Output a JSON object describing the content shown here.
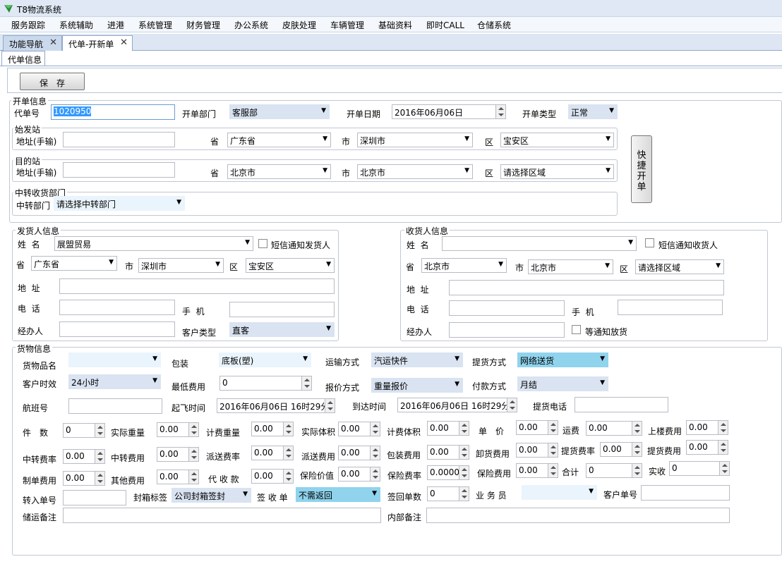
{
  "window": {
    "title": "T8物流系统"
  },
  "menu": [
    "服务跟踪",
    "系统辅助",
    "进港",
    "系统管理",
    "财务管理",
    "办公系统",
    "皮肤处理",
    "车辆管理",
    "基础资料",
    "即时CALL",
    "仓储系统"
  ],
  "tabs": [
    {
      "label": "功能导航",
      "close": "✕"
    },
    {
      "label": "代单-开新单",
      "close": "✕"
    }
  ],
  "subtab": "代单信息",
  "toolbar": {
    "save": "保　存"
  },
  "quick_button": "快捷开单",
  "open": {
    "legend": "开单信息",
    "bill_no_label": "代单号",
    "bill_no": "1020950",
    "dept_label": "开单部门",
    "dept": "客服部",
    "date_label": "开单日期",
    "date": "2016年06月06日",
    "type_label": "开单类型",
    "type": "正常"
  },
  "origin": {
    "legend": "始发站",
    "addr_label": "地址(手输)",
    "addr": "",
    "prov_label": "省",
    "prov": "广东省",
    "city_label": "市",
    "city": "深圳市",
    "dist_label": "区",
    "dist": "宝安区"
  },
  "dest": {
    "legend": "目的站",
    "addr_label": "地址(手输)",
    "addr": "",
    "prov_label": "省",
    "prov": "北京市",
    "city_label": "市",
    "city": "北京市",
    "dist_label": "区",
    "dist": "请选择区域"
  },
  "transfer": {
    "legend": "中转收货部门",
    "label": "中转部门",
    "value": "请选择中转部门"
  },
  "sender": {
    "legend": "发货人信息",
    "name_label": "姓  名",
    "name": "展盟贸易",
    "sms": "短信通知发货人",
    "prov_label": "省",
    "prov": "广东省",
    "city_label": "市",
    "city": "深圳市",
    "dist_label": "区",
    "dist": "宝安区",
    "addr_label": "地  址",
    "tel_label": "电  话",
    "mobile_label": "手  机",
    "agent_label": "经办人",
    "ctype_label": "客户类型",
    "ctype": "直客"
  },
  "receiver": {
    "legend": "收货人信息",
    "name_label": "姓  名",
    "name": "",
    "sms": "短信通知收货人",
    "prov_label": "省",
    "prov": "北京市",
    "city_label": "市",
    "city": "北京市",
    "dist_label": "区",
    "dist": "请选择区域",
    "addr_label": "地  址",
    "tel_label": "电  话",
    "mobile_label": "手  机",
    "agent_label": "经办人",
    "wait": "等通知放货"
  },
  "goods": {
    "legend": "货物信息",
    "name_label": "货物品名",
    "name": "",
    "pack_label": "包装",
    "pack": "底板(塑)",
    "trans_label": "运输方式",
    "trans": "汽运快件",
    "pick_label": "提货方式",
    "pick": "网络送货",
    "aging_label": "客户时效",
    "aging": "24小时",
    "minfee_label": "最低费用",
    "minfee": "0",
    "quote_label": "报价方式",
    "quote": "重量报价",
    "pay_label": "付款方式",
    "pay": "月结",
    "flight_label": "航班号",
    "flight": "",
    "dep_label": "起飞时间",
    "dep": "2016年06月06日 16时29分",
    "arr_label": "到达时间",
    "arr": "2016年06月06日 16时29分",
    "pickphone_label": "提货电话",
    "pickphone": "",
    "row1": [
      {
        "label": "件　数",
        "value": "0"
      },
      {
        "label": "实际重量",
        "value": "0.00"
      },
      {
        "label": "计费重量",
        "value": "0.00"
      },
      {
        "label": "实际体积",
        "value": "0.00"
      },
      {
        "label": "计费体积",
        "value": "0.00"
      },
      {
        "label": "单　价",
        "value": "0.00"
      },
      {
        "label": "运费",
        "value": "0.00"
      },
      {
        "label": "上楼费用",
        "value": "0.00"
      }
    ],
    "row2": [
      {
        "label": "中转费率",
        "value": "0.00"
      },
      {
        "label": "中转费用",
        "value": "0.00"
      },
      {
        "label": "派送费率",
        "value": "0.00"
      },
      {
        "label": "派送费用",
        "value": "0.00"
      },
      {
        "label": "包装费用",
        "value": "0.00"
      },
      {
        "label": "卸货费用",
        "value": "0.00"
      },
      {
        "label": "提货费率",
        "value": "0.00"
      },
      {
        "label": "提货费用",
        "value": "0.00"
      }
    ],
    "row3": [
      {
        "label": "制单费用",
        "value": "0.00"
      },
      {
        "label": "其他费用",
        "value": "0.00"
      },
      {
        "label": "代 收 款",
        "value": "0.00"
      },
      {
        "label": "保险价值",
        "value": "0.00"
      },
      {
        "label": "保险费率",
        "value": "0.0000"
      },
      {
        "label": "保险费用",
        "value": "0.00"
      },
      {
        "label": "合计",
        "value": "0"
      },
      {
        "label": "实收",
        "value": "0"
      }
    ],
    "in_label": "转入单号",
    "in": "",
    "seal_label": "封箱标签",
    "seal": "公司封箱签封",
    "sign_label": "签 收 单",
    "sign": "不需返回",
    "signcount_label": "签回单数",
    "signcount": "0",
    "sales_label": "业 务 员",
    "sales": "",
    "custno_label": "客户单号",
    "custno": "",
    "remark_label": "储运备注",
    "remark": "",
    "inner_label": "内部备注",
    "inner": ""
  },
  "colors": {
    "highlight": "#3399ff",
    "select_blue": "#d9e3f1",
    "select_cyan": "#8fd3ed"
  }
}
